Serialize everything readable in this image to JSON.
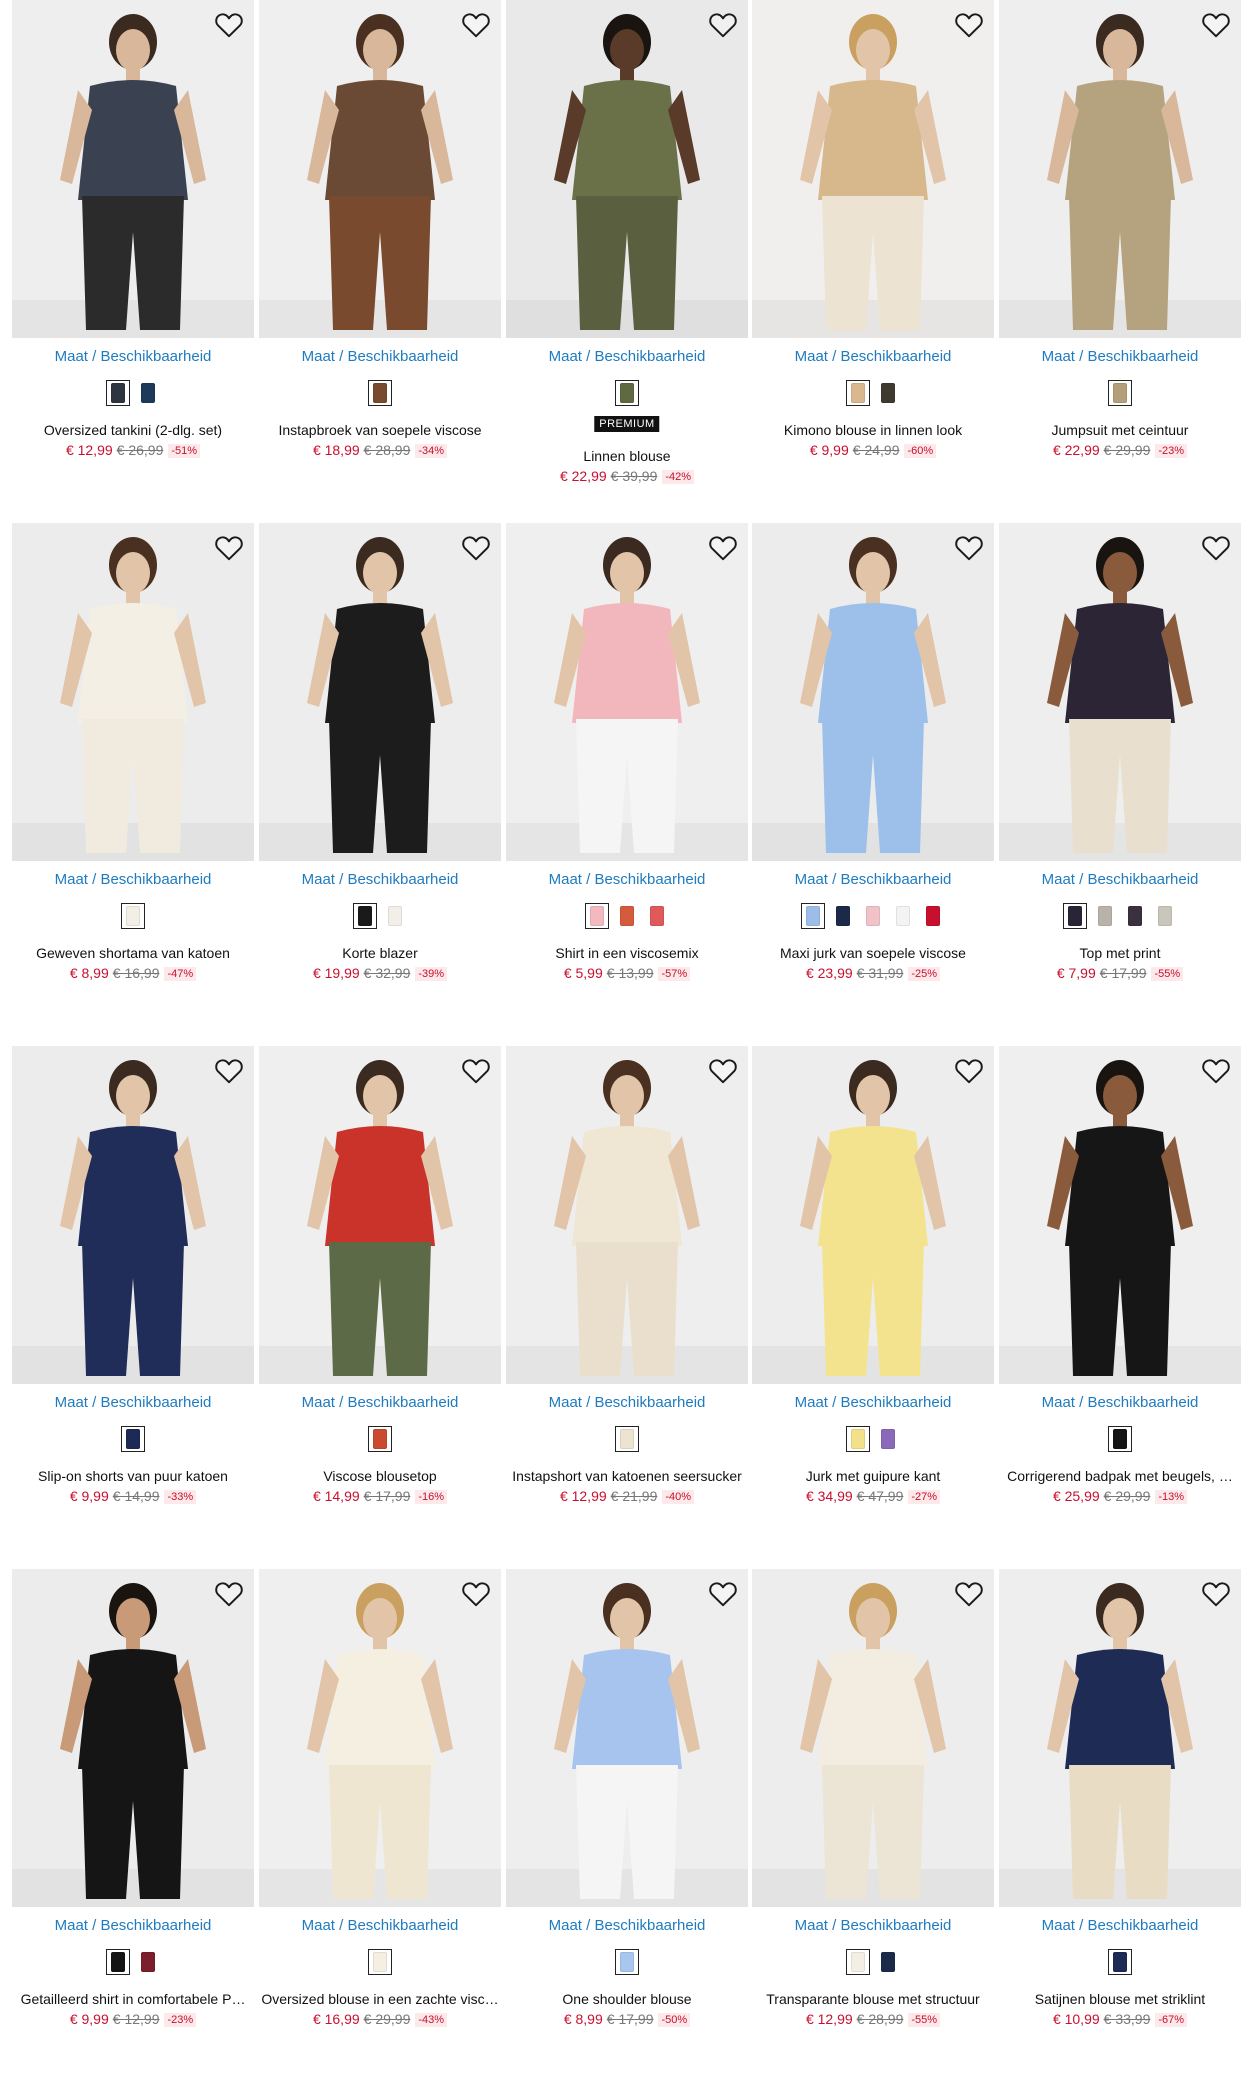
{
  "size_link_label": "Maat / Beschikbaarheid",
  "colors": {
    "sale": "#c8102e",
    "link": "#1f7bbf",
    "discount_bg": "#fde8ea"
  },
  "products": [
    {
      "name": "Oversized tankini (2-dlg. set)",
      "price": "€ 12,99",
      "old_price": "€ 26,99",
      "discount": "-51%",
      "swatches": [
        "#2e3440",
        "#1e3a5a"
      ],
      "bg": "#eeeeee",
      "fig": {
        "top": "#3a4150",
        "bottom": "#2b2b2b",
        "skin": "#d9b79a",
        "hair": "#3a2a20"
      }
    },
    {
      "name": "Instapbroek van soepele viscose",
      "price": "€ 18,99",
      "old_price": "€ 28,99",
      "discount": "-34%",
      "swatches": [
        "#7a4a2e"
      ],
      "bg": "#efefef",
      "fig": {
        "top": "#6b4a35",
        "bottom": "#7a4a2e",
        "skin": "#d9b79a",
        "hair": "#4a3020"
      }
    },
    {
      "name": "Linnen blouse",
      "price": "€ 22,99",
      "old_price": "€ 39,99",
      "discount": "-42%",
      "badge": "PREMIUM",
      "swatches": [
        "#5f6a40"
      ],
      "bg": "#e9e9e9",
      "fig": {
        "top": "#6a7048",
        "bottom": "#5a5f40",
        "skin": "#5a3a28",
        "hair": "#1a1410"
      }
    },
    {
      "name": "Kimono blouse in linnen look",
      "price": "€ 9,99",
      "old_price": "€ 24,99",
      "discount": "-60%",
      "swatches": [
        "#d9b890",
        "#3f3a30"
      ],
      "bg": "#f0efed",
      "fig": {
        "top": "#d7b78c",
        "bottom": "#ece3d2",
        "skin": "#e2c4a8",
        "hair": "#c9a060"
      }
    },
    {
      "name": "Jumpsuit met ceintuur",
      "price": "€ 22,99",
      "old_price": "€ 29,99",
      "discount": "-23%",
      "swatches": [
        "#b3a07a"
      ],
      "bg": "#eeeeee",
      "fig": {
        "top": "#b5a27e",
        "bottom": "#b5a27e",
        "skin": "#d9b79a",
        "hair": "#3a2a20"
      }
    },
    {
      "name": "Geweven shortama van katoen",
      "price": "€ 8,99",
      "old_price": "€ 16,99",
      "discount": "-47%",
      "swatches": [
        "#f3efe6"
      ],
      "bg": "#ececec",
      "fig": {
        "top": "#f4efe4",
        "bottom": "#f1ebdf",
        "skin": "#e2c4a8",
        "hair": "#4a3020"
      }
    },
    {
      "name": "Korte blazer",
      "price": "€ 19,99",
      "old_price": "€ 32,99",
      "discount": "-39%",
      "swatches": [
        "#1a1a1a",
        "#f2efe9"
      ],
      "bg": "#ededed",
      "fig": {
        "top": "#1c1c1c",
        "bottom": "#1c1c1c",
        "skin": "#e2c4a8",
        "hair": "#3a2a20"
      }
    },
    {
      "name": "Shirt in een viscosemix",
      "price": "€ 5,99",
      "old_price": "€ 13,99",
      "discount": "-57%",
      "swatches": [
        "#f4b9be",
        "#d65a3c",
        "#e05a5a"
      ],
      "bg": "#efefef",
      "fig": {
        "top": "#f2b7bd",
        "bottom": "#f5f5f5",
        "skin": "#e2c4a8",
        "hair": "#3a2a20"
      }
    },
    {
      "name": "Maxi jurk van soepele viscose",
      "price": "€ 23,99",
      "old_price": "€ 31,99",
      "discount": "-25%",
      "swatches": [
        "#9bbde8",
        "#1c2a4a",
        "#f1c3c9",
        "#f3f3f3",
        "#c8102e"
      ],
      "bg": "#ececec",
      "fig": {
        "top": "#9cc0ea",
        "bottom": "#9cc0ea",
        "skin": "#e2c4a8",
        "hair": "#4a3020"
      }
    },
    {
      "name": "Top met print",
      "price": "€ 7,99",
      "old_price": "€ 17,99",
      "discount": "-55%",
      "swatches": [
        "#2a2438",
        "#b9b2a8",
        "#3a3040",
        "#c9c6bc"
      ],
      "bg": "#eeeeee",
      "fig": {
        "top": "#2b2536",
        "bottom": "#e9dfcf",
        "skin": "#8a5a3c",
        "hair": "#1a1410"
      }
    },
    {
      "name": "Slip-on shorts van puur katoen",
      "price": "€ 9,99",
      "old_price": "€ 14,99",
      "discount": "-33%",
      "swatches": [
        "#1c2a55"
      ],
      "bg": "#ececec",
      "fig": {
        "top": "#1f2d58",
        "bottom": "#1f2d58",
        "skin": "#e2c4a8",
        "hair": "#3a2a20"
      }
    },
    {
      "name": "Viscose blousetop",
      "price": "€ 14,99",
      "old_price": "€ 17,99",
      "discount": "-16%",
      "swatches": [
        "#c94a2e"
      ],
      "bg": "#efefef",
      "fig": {
        "top": "#c9332a",
        "bottom": "#5c6a48",
        "skin": "#e2c4a8",
        "hair": "#3a2a20"
      }
    },
    {
      "name": "Instapshort van katoenen seersucker",
      "price": "€ 12,99",
      "old_price": "€ 21,99",
      "discount": "-40%",
      "swatches": [
        "#ece3d1"
      ],
      "bg": "#eeeeee",
      "fig": {
        "top": "#efe6d4",
        "bottom": "#e9dfcc",
        "skin": "#e2c4a8",
        "hair": "#4a3020"
      }
    },
    {
      "name": "Jurk met guipure kant",
      "price": "€ 34,99",
      "old_price": "€ 47,99",
      "discount": "-27%",
      "swatches": [
        "#f3e08a",
        "#8a6ab8"
      ],
      "bg": "#ededed",
      "fig": {
        "top": "#f4e38e",
        "bottom": "#f4e38e",
        "skin": "#e2c4a8",
        "hair": "#3a2a20"
      }
    },
    {
      "name": "Corrigerend badpak met beugels, …",
      "price": "€ 25,99",
      "old_price": "€ 29,99",
      "discount": "-13%",
      "swatches": [
        "#141414"
      ],
      "bg": "#efefef",
      "fig": {
        "top": "#161616",
        "bottom": "#161616",
        "skin": "#8a5a3c",
        "hair": "#1a1410"
      }
    },
    {
      "name": "Getailleerd shirt in comfortabele P…",
      "price": "€ 9,99",
      "old_price": "€ 12,99",
      "discount": "-23%",
      "swatches": [
        "#141414",
        "#7a1f2b"
      ],
      "bg": "#ececec",
      "fig": {
        "top": "#151515",
        "bottom": "#151515",
        "skin": "#c99a78",
        "hair": "#1a1410"
      }
    },
    {
      "name": "Oversized blouse in een zachte visc…",
      "price": "€ 16,99",
      "old_price": "€ 29,99",
      "discount": "-43%",
      "swatches": [
        "#f4efe2"
      ],
      "bg": "#efefef",
      "fig": {
        "top": "#f5efe1",
        "bottom": "#efe6d2",
        "skin": "#e2c4a8",
        "hair": "#c9a060"
      }
    },
    {
      "name": "One shoulder blouse",
      "price": "€ 8,99",
      "old_price": "€ 17,99",
      "discount": "-50%",
      "swatches": [
        "#a9c6ee"
      ],
      "bg": "#eeeeee",
      "fig": {
        "top": "#a6c4ee",
        "bottom": "#f5f5f5",
        "skin": "#e2c4a8",
        "hair": "#4a3020"
      }
    },
    {
      "name": "Transparante blouse met structuur",
      "price": "€ 12,99",
      "old_price": "€ 28,99",
      "discount": "-55%",
      "swatches": [
        "#f4efe4",
        "#1c2a4a"
      ],
      "bg": "#ededed",
      "fig": {
        "top": "#f3ece0",
        "bottom": "#ece4d4",
        "skin": "#e2c4a8",
        "hair": "#c9a060"
      }
    },
    {
      "name": "Satijnen blouse met striklint",
      "price": "€ 10,99",
      "old_price": "€ 33,99",
      "discount": "-67%",
      "swatches": [
        "#1c2a55"
      ],
      "bg": "#eeeeee",
      "fig": {
        "top": "#1e2c55",
        "bottom": "#e8dcc4",
        "skin": "#e2c4a8",
        "hair": "#3a2a20"
      }
    }
  ]
}
